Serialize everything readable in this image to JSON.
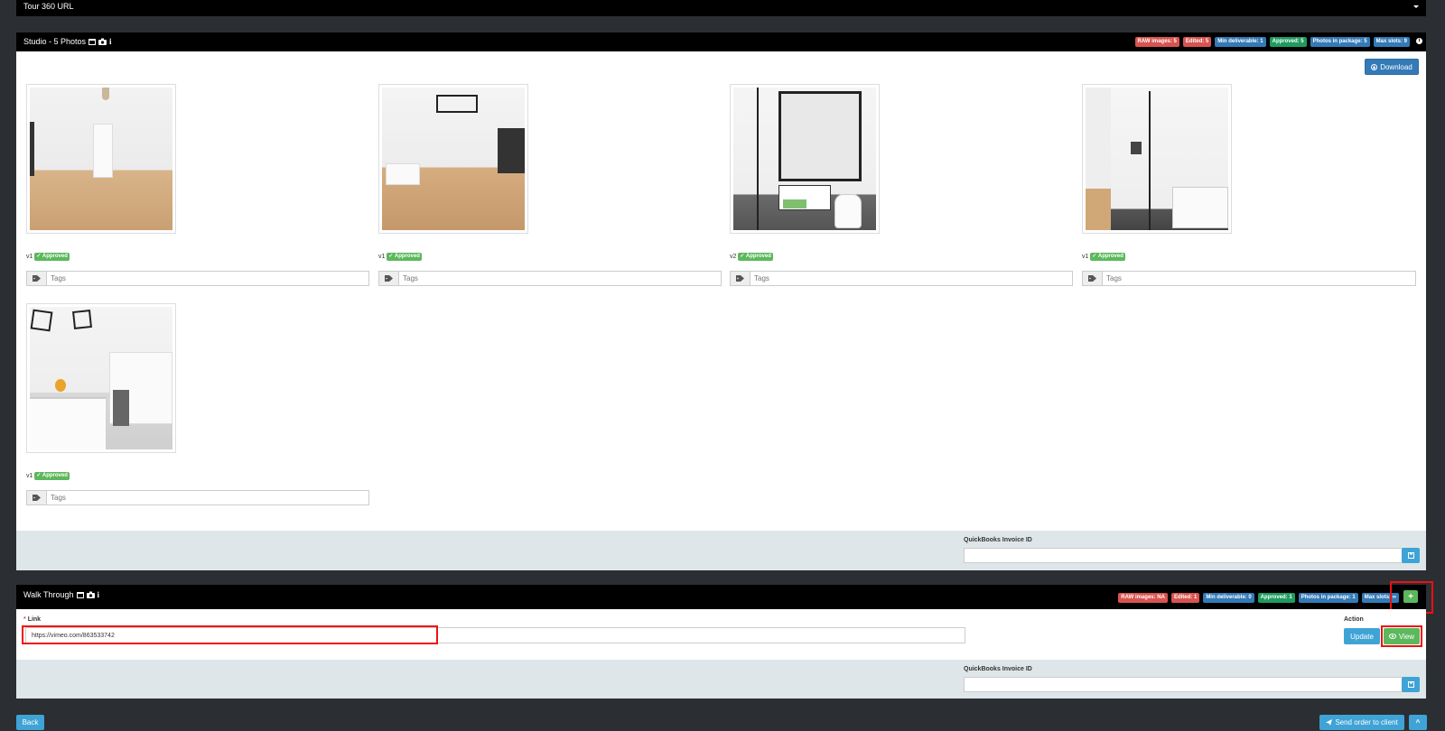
{
  "tour_bar": {
    "title": "Tour 360 URL"
  },
  "studio": {
    "title": "Studio - 5 Photos",
    "badges": [
      "RAW images: 5",
      "Edited: 5",
      "Min deliverable: 1",
      "Approved: 5",
      "Photos in package: 5",
      "Max slots: 9"
    ],
    "download_label": "Download",
    "photos": [
      {
        "version": "v1",
        "status": "Approved",
        "tags_placeholder": "Tags"
      },
      {
        "version": "v1",
        "status": "Approved",
        "tags_placeholder": "Tags"
      },
      {
        "version": "v2",
        "status": "Approved",
        "tags_placeholder": "Tags"
      },
      {
        "version": "v1",
        "status": "Approved",
        "tags_placeholder": "Tags"
      },
      {
        "version": "v1",
        "status": "Approved",
        "tags_placeholder": "Tags"
      }
    ],
    "qb_label": "QuickBooks Invoice ID",
    "qb_value": ""
  },
  "walkthrough": {
    "title": "Walk Through",
    "badges": [
      "RAW images: NA",
      "Edited: 1",
      "Min deliverable: 0",
      "Approved: 1",
      "Photos in package: 1",
      "Max slots: ∞"
    ],
    "add_label": "+",
    "link_label": "Link",
    "required_mark": "*",
    "link_value": "https://vimeo.com/863533742",
    "action_label": "Action",
    "update_label": "Update",
    "view_label": "View",
    "qb_label": "QuickBooks Invoice ID",
    "qb_value": ""
  },
  "footer": {
    "back_label": "Back",
    "send_label": "Send order to client",
    "up_label": "^"
  },
  "colors": {
    "badge_red": "#d9534f",
    "badge_blue": "#337ab7",
    "badge_green": "#1f9b5f",
    "approved_green": "#5cb85c",
    "highlight_red": "#e11111"
  }
}
